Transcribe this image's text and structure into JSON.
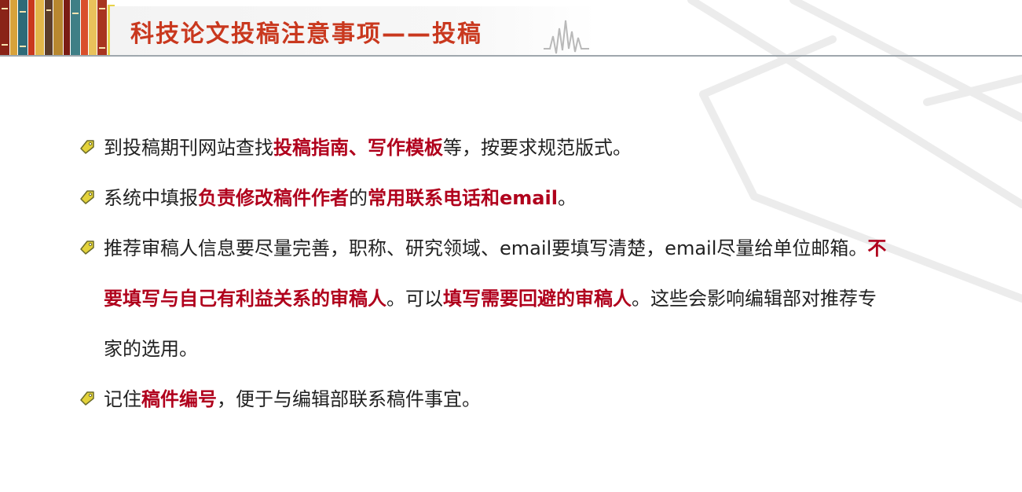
{
  "title": "科技论文投稿注意事项——投稿",
  "colors": {
    "title": "#c9381e",
    "highlight": "#b0001c",
    "bullet": "#e3d23a"
  },
  "items": [
    {
      "lines": [
        {
          "segments": [
            {
              "text": "到投稿期刊网站查找",
              "em": false
            },
            {
              "text": "投稿指南、写作模板",
              "em": true
            },
            {
              "text": "等，按要求规范版式。",
              "em": false
            }
          ]
        }
      ]
    },
    {
      "lines": [
        {
          "segments": [
            {
              "text": "系统中填报",
              "em": false
            },
            {
              "text": "负责修改稿件作者",
              "em": true
            },
            {
              "text": "的",
              "em": false
            },
            {
              "text": "常用联系电话和email",
              "em": true
            },
            {
              "text": "。",
              "em": false
            }
          ]
        }
      ]
    },
    {
      "lines": [
        {
          "segments": [
            {
              "text": "推荐审稿人信息要尽量完善，职称、研究领域、email要填写清楚，email尽量给单位邮箱。",
              "em": false
            },
            {
              "text": "不",
              "em": true
            }
          ]
        },
        {
          "segments": [
            {
              "text": "要填写与自己有利益关系的审稿人",
              "em": true
            },
            {
              "text": "。可以",
              "em": false
            },
            {
              "text": "填写需要回避的审稿人",
              "em": true
            },
            {
              "text": "。这些会影响编辑部对推荐专",
              "em": false
            }
          ]
        },
        {
          "segments": [
            {
              "text": "家的选用。",
              "em": false
            }
          ]
        }
      ]
    },
    {
      "lines": [
        {
          "segments": [
            {
              "text": "记住",
              "em": false
            },
            {
              "text": "稿件编号",
              "em": true
            },
            {
              "text": "，便于与编辑部联系稿件事宜。",
              "em": false
            }
          ]
        }
      ]
    }
  ]
}
